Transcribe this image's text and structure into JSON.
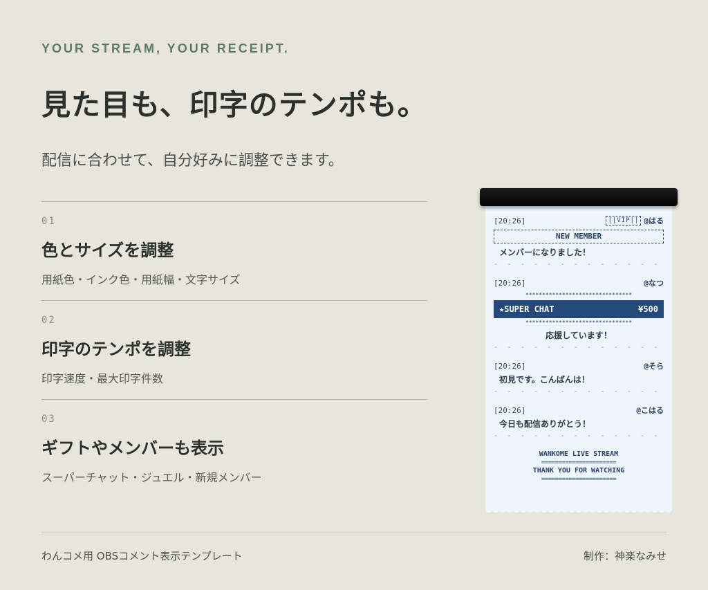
{
  "hero": {
    "eyebrow": "YOUR STREAM, YOUR RECEIPT.",
    "headline": "見た目も、印字のテンポも。",
    "subhead": "配信に合わせて、自分好みに調整できます。"
  },
  "features": [
    {
      "num": "01",
      "title": "色とサイズを調整",
      "desc": "用紙色・インク色・用紙幅・文字サイズ"
    },
    {
      "num": "02",
      "title": "印字のテンポを調整",
      "desc": "印字速度・最大印字件数"
    },
    {
      "num": "03",
      "title": "ギフトやメンバーも表示",
      "desc": "スーパーチャット・ジュエル・新規メンバー"
    }
  ],
  "receipt": {
    "entries": [
      {
        "time": "[20:26]",
        "badge": "||VIP||",
        "user": "@はる",
        "banner": "NEW MEMBER",
        "message": "メンバーになりました！"
      },
      {
        "time": "[20:26]",
        "user": "@なつ",
        "stars": "********************************",
        "superchat_label": "★SUPER CHAT",
        "superchat_amount": "¥500",
        "message": "応援しています！"
      },
      {
        "time": "[20:26]",
        "user": "@そら",
        "message": "初見です。こんばんは！"
      },
      {
        "time": "[20:26]",
        "user": "@こはる",
        "message": "今日も配信ありがとう！"
      }
    ],
    "dash": "- - - - - - - - - - - - - - - -",
    "footer": {
      "line1": "WANKOME LIVE STREAM",
      "eq": "======================",
      "line2": "THANK YOU FOR WATCHING"
    }
  },
  "footer": {
    "left": "わんコメ用 OBSコメント表示テンプレート",
    "right": "制作：神楽なみせ"
  },
  "colors": {
    "background": "#e8e6dc",
    "accent_green": "#5a7a62",
    "receipt_paper": "#eef5fc",
    "receipt_ink": "#2a3f66",
    "superchat_bar": "#24497a"
  }
}
